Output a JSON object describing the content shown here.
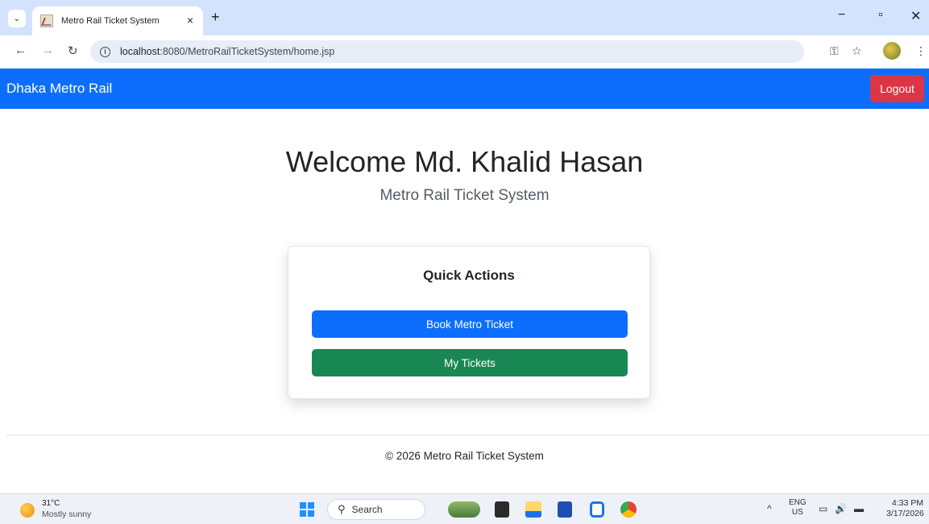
{
  "browser": {
    "tab_title": "Metro Rail Ticket System",
    "tab_close": "×",
    "new_tab": "+",
    "url_host": "localhost",
    "url_rest": ":8080/MetroRailTicketSystem/home.jsp",
    "minimize": "−",
    "restore": "▫",
    "close": "✕"
  },
  "navbar": {
    "brand": "Dhaka Metro Rail",
    "logout_label": "Logout"
  },
  "main": {
    "welcome": "Welcome Md. Khalid Hasan",
    "subtitle": "Metro Rail Ticket System"
  },
  "quick_actions": {
    "title": "Quick Actions",
    "book_label": "Book Metro Ticket",
    "tickets_label": "My Tickets"
  },
  "footer": {
    "text": "© 2026 Metro Rail Ticket System"
  },
  "taskbar": {
    "temperature": "31°C",
    "weather": "Mostly sunny",
    "search_placeholder": "Search",
    "lang_top": "ENG",
    "lang_bottom": "US",
    "time": "4:33 PM",
    "date": "3/17/2026"
  },
  "colors": {
    "primary": "#0d6efd",
    "success": "#198754",
    "danger": "#dc3545"
  }
}
